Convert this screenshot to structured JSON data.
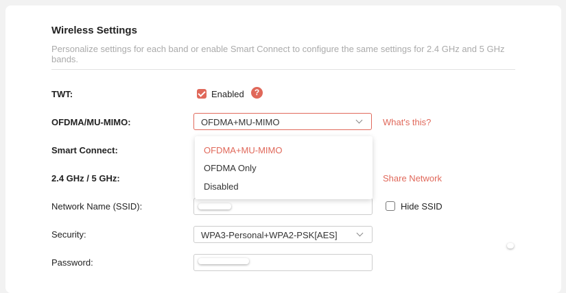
{
  "section": {
    "title": "Wireless Settings",
    "description": "Personalize settings for each band or enable Smart Connect to configure the same settings for 2.4 GHz and 5 GHz bands."
  },
  "twt": {
    "label": "TWT:",
    "checkbox_label": "Enabled",
    "checked": true,
    "help_glyph": "?"
  },
  "ofdma": {
    "label": "OFDMA/MU-MIMO:",
    "selected": "OFDMA+MU-MIMO",
    "link": "What's this?",
    "options": [
      "OFDMA+MU-MIMO",
      "OFDMA Only",
      "Disabled"
    ]
  },
  "smart_connect": {
    "label": "Smart Connect:"
  },
  "band": {
    "label": "2.4 GHz / 5 GHz:",
    "link": "Share Network"
  },
  "ssid": {
    "label": "Network Name (SSID):",
    "hide_label": "Hide SSID",
    "hide_checked": false
  },
  "security": {
    "label": "Security:",
    "selected": "WPA3-Personal+WPA2-PSK[AES]"
  },
  "password": {
    "label": "Password:"
  },
  "colors": {
    "accent": "#e0685a"
  }
}
